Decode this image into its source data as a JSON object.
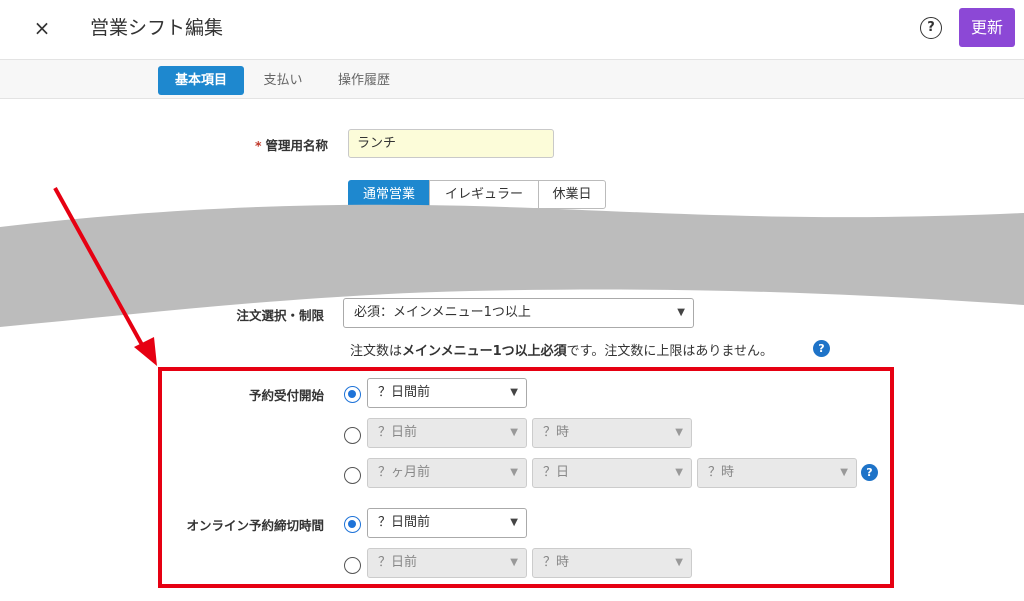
{
  "header": {
    "close_label": "×",
    "title": "営業シフト編集",
    "help_label": "?",
    "update_label": "更新"
  },
  "tabs": [
    {
      "label": "基本項目",
      "active": true
    },
    {
      "label": "支払い",
      "active": false
    },
    {
      "label": "操作履歴",
      "active": false
    }
  ],
  "form": {
    "name_label": "管理用名称",
    "required_mark": "*",
    "name_value": "ランチ",
    "shift_types": [
      "通常営業",
      "イレギュラー",
      "休業日"
    ],
    "order_label": "注文選択・制限",
    "order_value": "必須：メインメニュー1つ以上",
    "order_note_prefix": "注文数は",
    "order_note_bold": "メインメニュー1つ以上必須",
    "order_note_suffix": "です。注文数に上限はありません。",
    "reserve_start_label": "予約受付開始",
    "reserve_start": {
      "row1": [
        "？日間前"
      ],
      "row2": [
        "？日前",
        "？時"
      ],
      "row3": [
        "？ヶ月前",
        "？日",
        "？時"
      ]
    },
    "online_deadline_label": "オンライン予約締切時間",
    "online_deadline": {
      "row1": [
        "？日間前"
      ],
      "row2": [
        "？日前",
        "？時"
      ]
    }
  },
  "icons": {
    "close": "close-icon",
    "help": "help-circle-icon",
    "question": "question-icon",
    "chevron": "chevron-down-icon"
  },
  "colors": {
    "accent_blue": "#1e88cf",
    "update_purple": "#8c48d6",
    "highlight_red": "#e60012",
    "input_yellow": "#fcfcd9"
  }
}
